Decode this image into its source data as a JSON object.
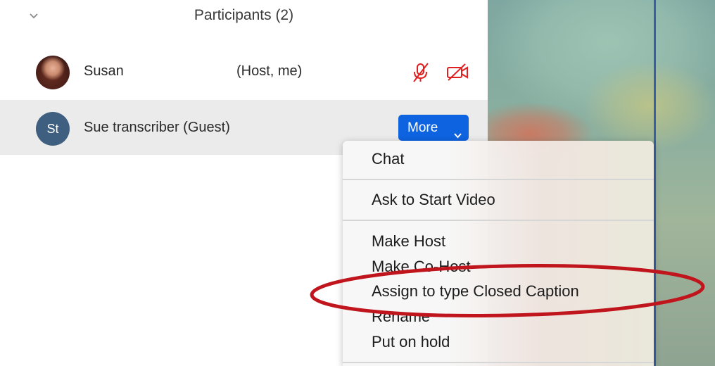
{
  "header": {
    "title": "Participants (2)"
  },
  "participants": [
    {
      "name": "Susan",
      "role": "(Host, me)"
    },
    {
      "name": "Sue transcriber (Guest)",
      "initials": "St"
    }
  ],
  "more_button": {
    "label": "More"
  },
  "menu": {
    "items": [
      "Chat",
      "Ask to Start Video",
      "Make Host",
      "Make Co-Host",
      "Assign to type Closed Caption",
      "Rename",
      "Put on hold"
    ]
  },
  "colors": {
    "more_button": "#0e63e0",
    "status_icons": "#e02020",
    "annotation_ellipse": "#c0151c",
    "avatar_initials_bg": "#3e5f7f"
  },
  "icons": {
    "collapse": "chevron-down-icon",
    "mic": "muted-microphone-icon",
    "video": "video-off-icon"
  }
}
